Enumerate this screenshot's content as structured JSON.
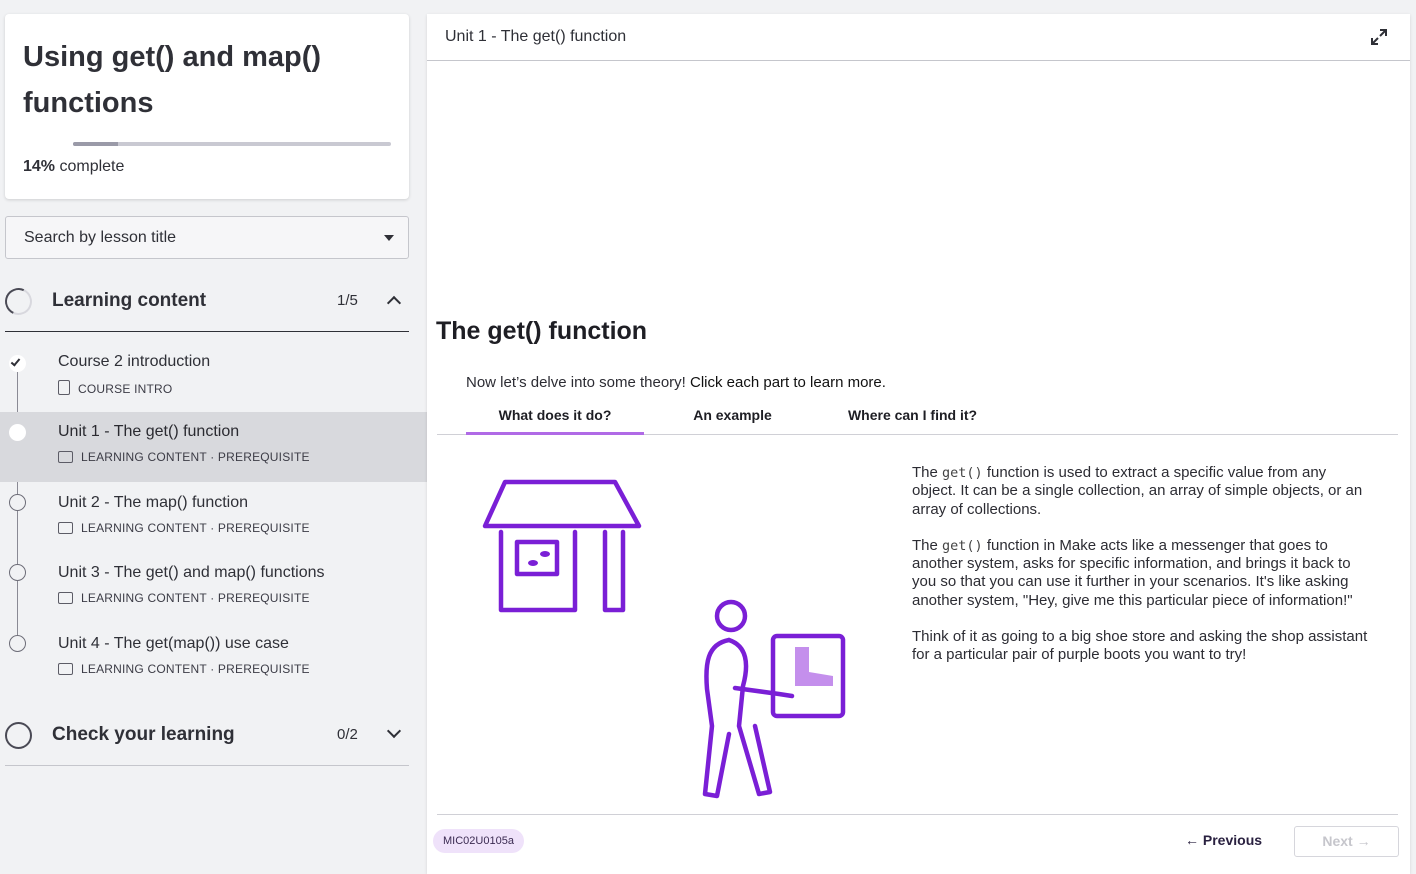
{
  "course": {
    "title": "Using get() and map() functions",
    "progress_percent": 14,
    "progress_value": "14%",
    "progress_suffix": " complete"
  },
  "search": {
    "placeholder": "Search by lesson title"
  },
  "sections": [
    {
      "title": "Learning content",
      "count": "1/5",
      "expanded": true
    },
    {
      "title": "Check your learning",
      "count": "0/2",
      "expanded": false
    }
  ],
  "lessons": [
    {
      "title": "Course 2 introduction",
      "meta": "COURSE INTRO",
      "status": "done"
    },
    {
      "title": "Unit 1 - The get() function",
      "meta": "LEARNING CONTENT · PREREQUISITE",
      "status": "active"
    },
    {
      "title": "Unit 2 - The map() function",
      "meta": "LEARNING CONTENT · PREREQUISITE",
      "status": "todo"
    },
    {
      "title": "Unit 3 - The get() and map() functions",
      "meta": "LEARNING CONTENT · PREREQUISITE",
      "status": "todo"
    },
    {
      "title": "Unit 4 - The get(map()) use case",
      "meta": "LEARNING CONTENT · PREREQUISITE",
      "status": "todo"
    }
  ],
  "main": {
    "header_title": "Unit 1 - The get() function",
    "heading": "The get() function",
    "intro_prefix": "Now let’s delve into some theory! ",
    "intro_emphasis": "Click each part to learn more.",
    "tabs": [
      "What does it do?",
      "An example",
      "Where can I find it?"
    ],
    "active_tab": 0,
    "paragraphs": [
      {
        "before": "The ",
        "code": "get()",
        "after": "  function is used to extract a specific value from any object. It can be a single collection, an array of simple objects, or an array of collections."
      },
      {
        "before": "The ",
        "code": "get()",
        "after": " function in Make acts like a messenger that goes to another system, asks for specific information, and brings it back to you so that you can use it further in your scenarios. It's like asking another system, \"Hey, give me this particular piece of information!\""
      },
      {
        "before": "",
        "code": "",
        "after": "Think of it as going to a big shoe store and asking the shop assistant for a particular pair of purple boots you want to try!"
      }
    ],
    "code_badge": "MIC02U0105a",
    "prev_label": "← Previous",
    "next_label": "Next →"
  },
  "colors": {
    "accent": "#7a1fd6",
    "accent_light": "#b06ae6",
    "badge_bg": "#efe2fa"
  },
  "icons": [
    "expand-icon",
    "chevron-up-icon",
    "chevron-down-icon",
    "check-icon",
    "document-icon",
    "screen-icon"
  ]
}
